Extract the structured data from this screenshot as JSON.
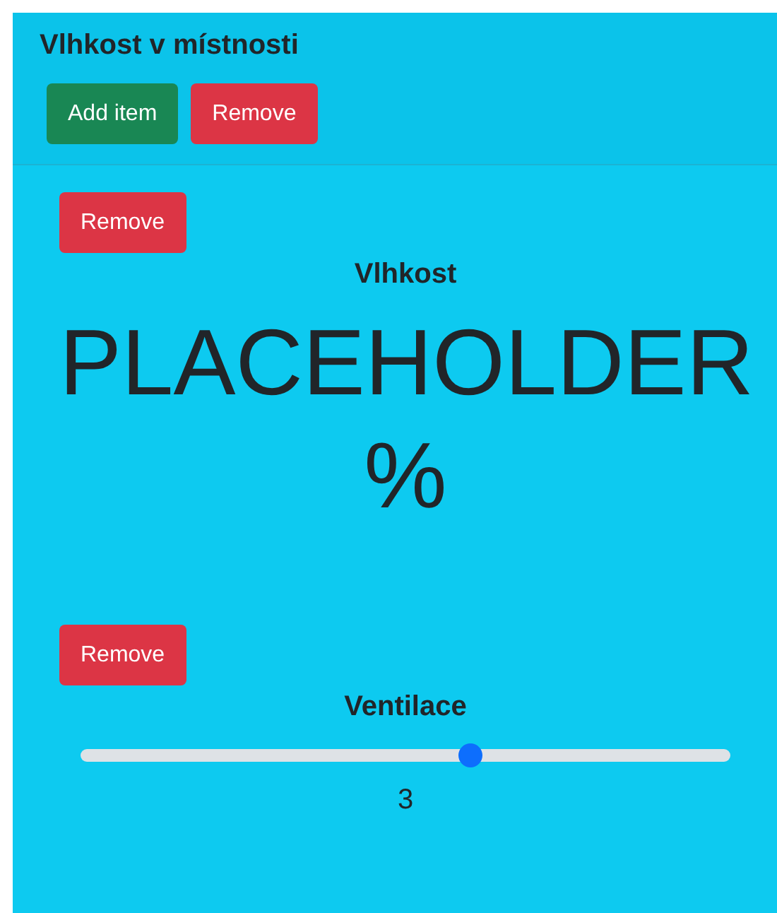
{
  "card": {
    "title": "Vlhkost v místnosti",
    "buttons": [
      {
        "label": "Add item",
        "kind": "add"
      },
      {
        "label": "Remove",
        "kind": "remove"
      }
    ]
  },
  "items": [
    {
      "kind": "display",
      "remove_label": "Remove",
      "title": "Vlhkost",
      "value": "PLACEHOLDER",
      "unit": "%"
    },
    {
      "kind": "slider",
      "remove_label": "Remove",
      "title": "Ventilace",
      "level": 0.6,
      "reading": "3"
    }
  ]
}
